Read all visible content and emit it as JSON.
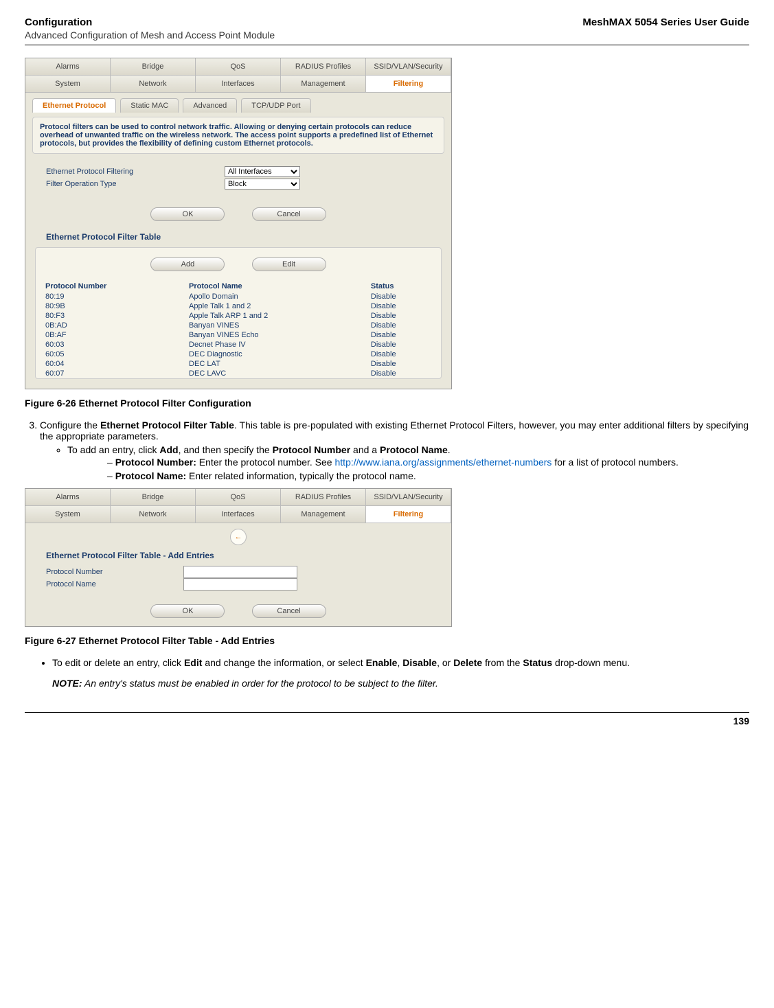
{
  "header": {
    "left_title": "Configuration",
    "right_title": "MeshMAX 5054 Series User Guide",
    "sub": "Advanced Configuration of Mesh and Access Point Module"
  },
  "fig26": {
    "tabs_top": [
      "Alarms",
      "Bridge",
      "QoS",
      "RADIUS Profiles",
      "SSID/VLAN/Security"
    ],
    "tabs_row2": [
      "System",
      "Network",
      "Interfaces",
      "Management",
      "Filtering"
    ],
    "subtabs": [
      "Ethernet Protocol",
      "Static MAC",
      "Advanced",
      "TCP/UDP Port"
    ],
    "desc": "Protocol filters can be used to control network traffic. Allowing or denying certain protocols can reduce overhead of unwanted traffic on the wireless network. The access point supports a predefined list of Ethernet protocols, but provides the flexibility of defining custom Ethernet protocols.",
    "field1_label": "Ethernet Protocol Filtering",
    "field1_value": "All Interfaces",
    "field2_label": "Filter Operation Type",
    "field2_value": "Block",
    "ok": "OK",
    "cancel": "Cancel",
    "table_title": "Ethernet Protocol Filter Table",
    "add": "Add",
    "edit": "Edit",
    "cols": [
      "Protocol Number",
      "Protocol Name",
      "Status"
    ],
    "rows": [
      [
        "80:19",
        "Apollo Domain",
        "Disable"
      ],
      [
        "80:9B",
        "Apple Talk 1 and 2",
        "Disable"
      ],
      [
        "80:F3",
        "Apple Talk ARP 1 and 2",
        "Disable"
      ],
      [
        "0B:AD",
        "Banyan VINES",
        "Disable"
      ],
      [
        "0B:AF",
        "Banyan VINES Echo",
        "Disable"
      ],
      [
        "60:03",
        "Decnet Phase IV",
        "Disable"
      ],
      [
        "60:05",
        "DEC Diagnostic",
        "Disable"
      ],
      [
        "60:04",
        "DEC LAT",
        "Disable"
      ],
      [
        "60:07",
        "DEC LAVC",
        "Disable"
      ]
    ],
    "caption": "Figure 6-26 Ethernet Protocol Filter Configuration"
  },
  "step3": {
    "lead_a": "Configure the ",
    "lead_bold": "Ethernet Protocol Filter Table",
    "lead_b": ". This table is pre-populated with existing Ethernet Protocol Filters, however, you may enter additional filters by specifying the appropriate parameters.",
    "bullet1_a": "To add an entry, click ",
    "bullet1_b1": "Add",
    "bullet1_c": ", and then specify the ",
    "bullet1_b2": "Protocol Number",
    "bullet1_d": " and a ",
    "bullet1_b3": "Protocol Name",
    "bullet1_e": ".",
    "dash1_label": "Protocol Number:",
    "dash1_text_a": " Enter the protocol number. See ",
    "dash1_link": "http://www.iana.org/assignments/ethernet-numbers",
    "dash1_text_b": " for a list of protocol numbers.",
    "dash2_label": "Protocol Name:",
    "dash2_text": " Enter related information, typically the protocol name."
  },
  "fig27": {
    "title": "Ethernet Protocol Filter Table - Add Entries",
    "f1": "Protocol Number",
    "f2": "Protocol Name",
    "ok": "OK",
    "cancel": "Cancel",
    "caption": "Figure 6-27 Ethernet Protocol Filter Table - Add Entries"
  },
  "after": {
    "bullet_a": "To edit or delete an entry, click ",
    "bullet_b1": "Edit",
    "bullet_c": " and change the information, or select ",
    "bullet_b2": "Enable",
    "bullet_d": ", ",
    "bullet_b3": "Disable",
    "bullet_e": ", or ",
    "bullet_b4": "Delete",
    "bullet_f": " from the ",
    "bullet_b5": "Status",
    "bullet_g": " drop-down menu.",
    "note_label": "NOTE:",
    "note_text": " An entry's status must be enabled in order for the protocol to be subject to the filter."
  },
  "footer": {
    "page": "139"
  }
}
